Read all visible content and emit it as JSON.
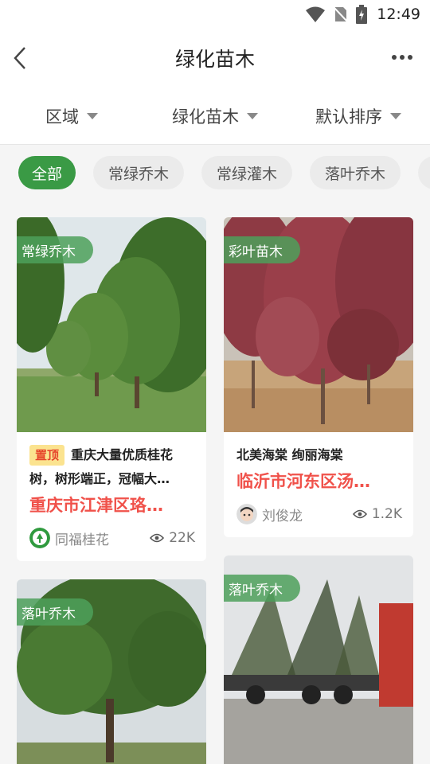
{
  "status": {
    "time": "12:49"
  },
  "nav": {
    "title": "绿化苗木"
  },
  "filters": [
    {
      "label": "区域"
    },
    {
      "label": "绿化苗木"
    },
    {
      "label": "默认排序"
    }
  ],
  "chips": [
    {
      "label": "全部",
      "active": true
    },
    {
      "label": "常绿乔木",
      "active": false
    },
    {
      "label": "常绿灌木",
      "active": false
    },
    {
      "label": "落叶乔木",
      "active": false
    }
  ],
  "cards": [
    {
      "tag": "常绿乔木",
      "pin": "置顶",
      "desc": "重庆大量优质桂花树，树形端正，冠幅大…",
      "location": "重庆市江津区珞…",
      "author": "同福桂花",
      "views": "22K"
    },
    {
      "tag": "彩叶苗木",
      "desc": "北美海棠 绚丽海棠",
      "location": "临沂市河东区汤…",
      "author": "刘俊龙",
      "views": "1.2K"
    },
    {
      "tag": "落叶乔木"
    },
    {
      "tag": "落叶乔木"
    }
  ],
  "colors": {
    "accent": "#3a9a45",
    "location": "#f0514a",
    "pin_bg": "#fbe38f"
  }
}
